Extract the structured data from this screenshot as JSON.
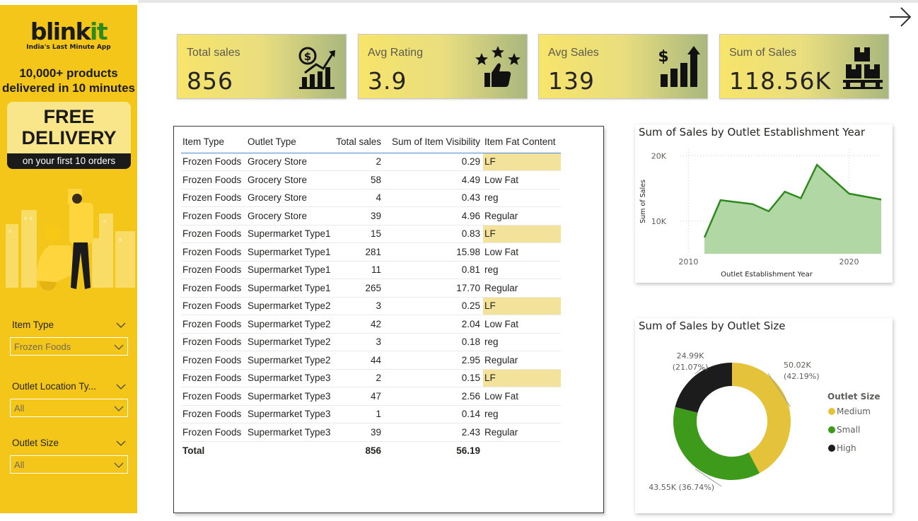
{
  "sidebar": {
    "brand_pre": "blink",
    "brand_post": "it",
    "tagline": "India's Last Minute App",
    "headline_1": "10,000+ products",
    "headline_2": "delivered in 10 minutes",
    "promo_big_1": "FREE",
    "promo_big_2": "DELIVERY",
    "promo_small": "on your first 10 orders",
    "filters": [
      {
        "label": "Item Type",
        "value": "Frozen Foods"
      },
      {
        "label": "Outlet Location Ty...",
        "value": "All"
      },
      {
        "label": "Outlet Size",
        "value": "All"
      }
    ]
  },
  "kpis": [
    {
      "label": "Total sales",
      "value": "856",
      "icon": "dollar-growth-icon"
    },
    {
      "label": "Avg Rating",
      "value": "3.9",
      "icon": "stars-thumbs-up-icon"
    },
    {
      "label": "Avg Sales",
      "value": "139",
      "icon": "dollar-bar-chart-icon"
    },
    {
      "label": "Sum of Sales",
      "value": "118.56K",
      "icon": "boxes-pallet-icon"
    }
  ],
  "table": {
    "headers": [
      "Item Type",
      "Outlet Type",
      "Total sales",
      "Sum of Item Visibility",
      "Item Fat Content"
    ],
    "rows": [
      [
        "Frozen Foods",
        "Grocery Store",
        "2",
        "0.29",
        "LF"
      ],
      [
        "Frozen Foods",
        "Grocery Store",
        "58",
        "4.49",
        "Low Fat"
      ],
      [
        "Frozen Foods",
        "Grocery Store",
        "4",
        "0.43",
        "reg"
      ],
      [
        "Frozen Foods",
        "Grocery Store",
        "39",
        "4.96",
        "Regular"
      ],
      [
        "Frozen Foods",
        "Supermarket Type1",
        "15",
        "0.83",
        "LF"
      ],
      [
        "Frozen Foods",
        "Supermarket Type1",
        "281",
        "15.98",
        "Low Fat"
      ],
      [
        "Frozen Foods",
        "Supermarket Type1",
        "11",
        "0.81",
        "reg"
      ],
      [
        "Frozen Foods",
        "Supermarket Type1",
        "265",
        "17.70",
        "Regular"
      ],
      [
        "Frozen Foods",
        "Supermarket Type2",
        "3",
        "0.25",
        "LF"
      ],
      [
        "Frozen Foods",
        "Supermarket Type2",
        "42",
        "2.04",
        "Low Fat"
      ],
      [
        "Frozen Foods",
        "Supermarket Type2",
        "3",
        "0.18",
        "reg"
      ],
      [
        "Frozen Foods",
        "Supermarket Type2",
        "44",
        "2.95",
        "Regular"
      ],
      [
        "Frozen Foods",
        "Supermarket Type3",
        "2",
        "0.15",
        "LF"
      ],
      [
        "Frozen Foods",
        "Supermarket Type3",
        "47",
        "2.56",
        "Low Fat"
      ],
      [
        "Frozen Foods",
        "Supermarket Type3",
        "1",
        "0.14",
        "reg"
      ],
      [
        "Frozen Foods",
        "Supermarket Type3",
        "39",
        "2.43",
        "Regular"
      ]
    ],
    "total": [
      "Total",
      "",
      "856",
      "56.19",
      ""
    ],
    "highlight_color": "#f2e29a"
  },
  "chart_data": [
    {
      "type": "area",
      "title": "Sum of Sales by Outlet Establishment Year",
      "xlabel": "Outlet Establishment Year",
      "ylabel": "Sum of Sales",
      "x": [
        2011,
        2012,
        2014,
        2015,
        2016,
        2017,
        2018,
        2020,
        2022
      ],
      "values": [
        7500,
        13200,
        12600,
        11500,
        14500,
        13500,
        18600,
        14200,
        13300
      ],
      "xlim": [
        2009.5,
        2022
      ],
      "ylim": [
        5000,
        21000
      ],
      "xticks": [
        2010,
        2020
      ],
      "yticks": [
        10000,
        20000
      ],
      "ytick_labels": [
        "10K",
        "20K"
      ],
      "xtick_labels": [
        "2010",
        "2020"
      ],
      "color": "#2f8a1e",
      "fill": "#a8d39b",
      "grid": true
    },
    {
      "type": "pie",
      "title": "Sum of Sales by Outlet Size",
      "legend_title": "Outlet Size",
      "legend_position": "right",
      "categories": [
        "Medium",
        "Small",
        "High"
      ],
      "values": [
        50.02,
        43.55,
        24.99
      ],
      "percents": [
        42.19,
        36.74,
        21.07
      ],
      "labels": [
        "50.02K\n(42.19%)",
        "43.55K (36.74%)",
        "24.99K\n(21.07%)"
      ],
      "colors": [
        "#e4c23a",
        "#3e9a1b",
        "#1c1c1c"
      ]
    }
  ]
}
